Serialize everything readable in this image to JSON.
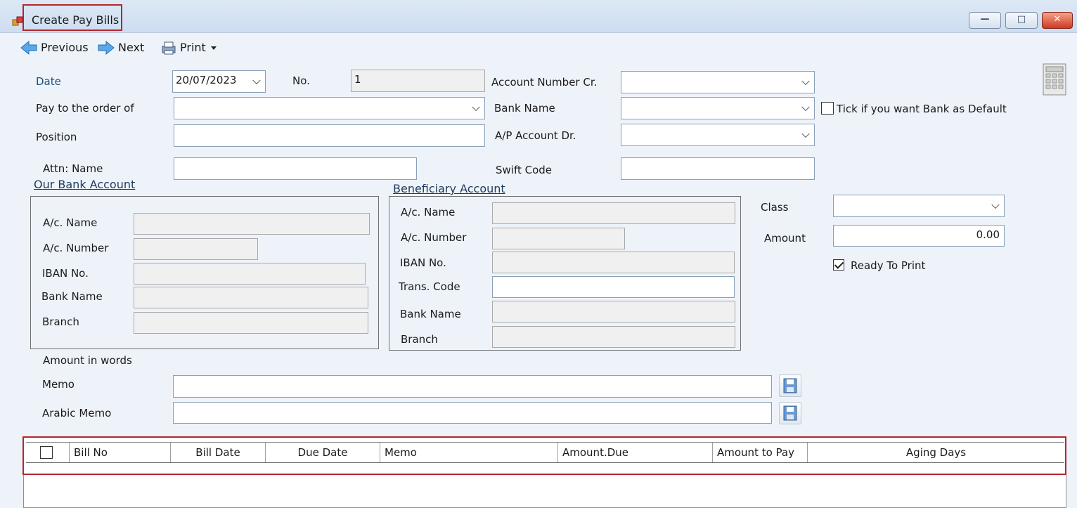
{
  "window": {
    "title": "Create Pay Bills",
    "minimize": "—",
    "maximize": "□",
    "close": "✕"
  },
  "toolbar": {
    "previous": "Previous",
    "next": "Next",
    "print": "Print"
  },
  "form": {
    "date_label": "Date",
    "date_value": "20/07/2023",
    "no_label": "No.",
    "no_value": "1",
    "account_cr_label": "Account Number Cr.",
    "pay_to_label": "Pay to the order of",
    "bank_name_label": "Bank Name",
    "bank_default_label": "Tick if you want Bank as Default",
    "position_label": "Position",
    "ap_account_label": "A/P Account Dr.",
    "attn_label": "Attn:  Name",
    "swift_label": "Swift Code",
    "class_label": "Class",
    "amount_label": "Amount",
    "amount_value": "0.00",
    "ready_print_label": "Ready To Print",
    "amount_words_label": "Amount in words",
    "memo_label": "Memo",
    "arabic_memo_label": "Arabic Memo"
  },
  "our_bank": {
    "title": "Our Bank Account",
    "ac_name": "A/c. Name",
    "ac_number": "A/c. Number",
    "iban": "IBAN No.",
    "bank_name": "Bank Name",
    "branch": "Branch"
  },
  "beneficiary": {
    "title": "Beneficiary Account",
    "ac_name": "A/c. Name",
    "ac_number": "A/c. Number",
    "iban": "IBAN No.",
    "trans_code": "Trans. Code",
    "bank_name": "Bank Name",
    "branch": "Branch"
  },
  "grid": {
    "columns": [
      "Bill No",
      "Bill Date",
      "Due Date",
      "Memo",
      "Amount.Due",
      "Amount to Pay",
      "Aging Days"
    ]
  }
}
